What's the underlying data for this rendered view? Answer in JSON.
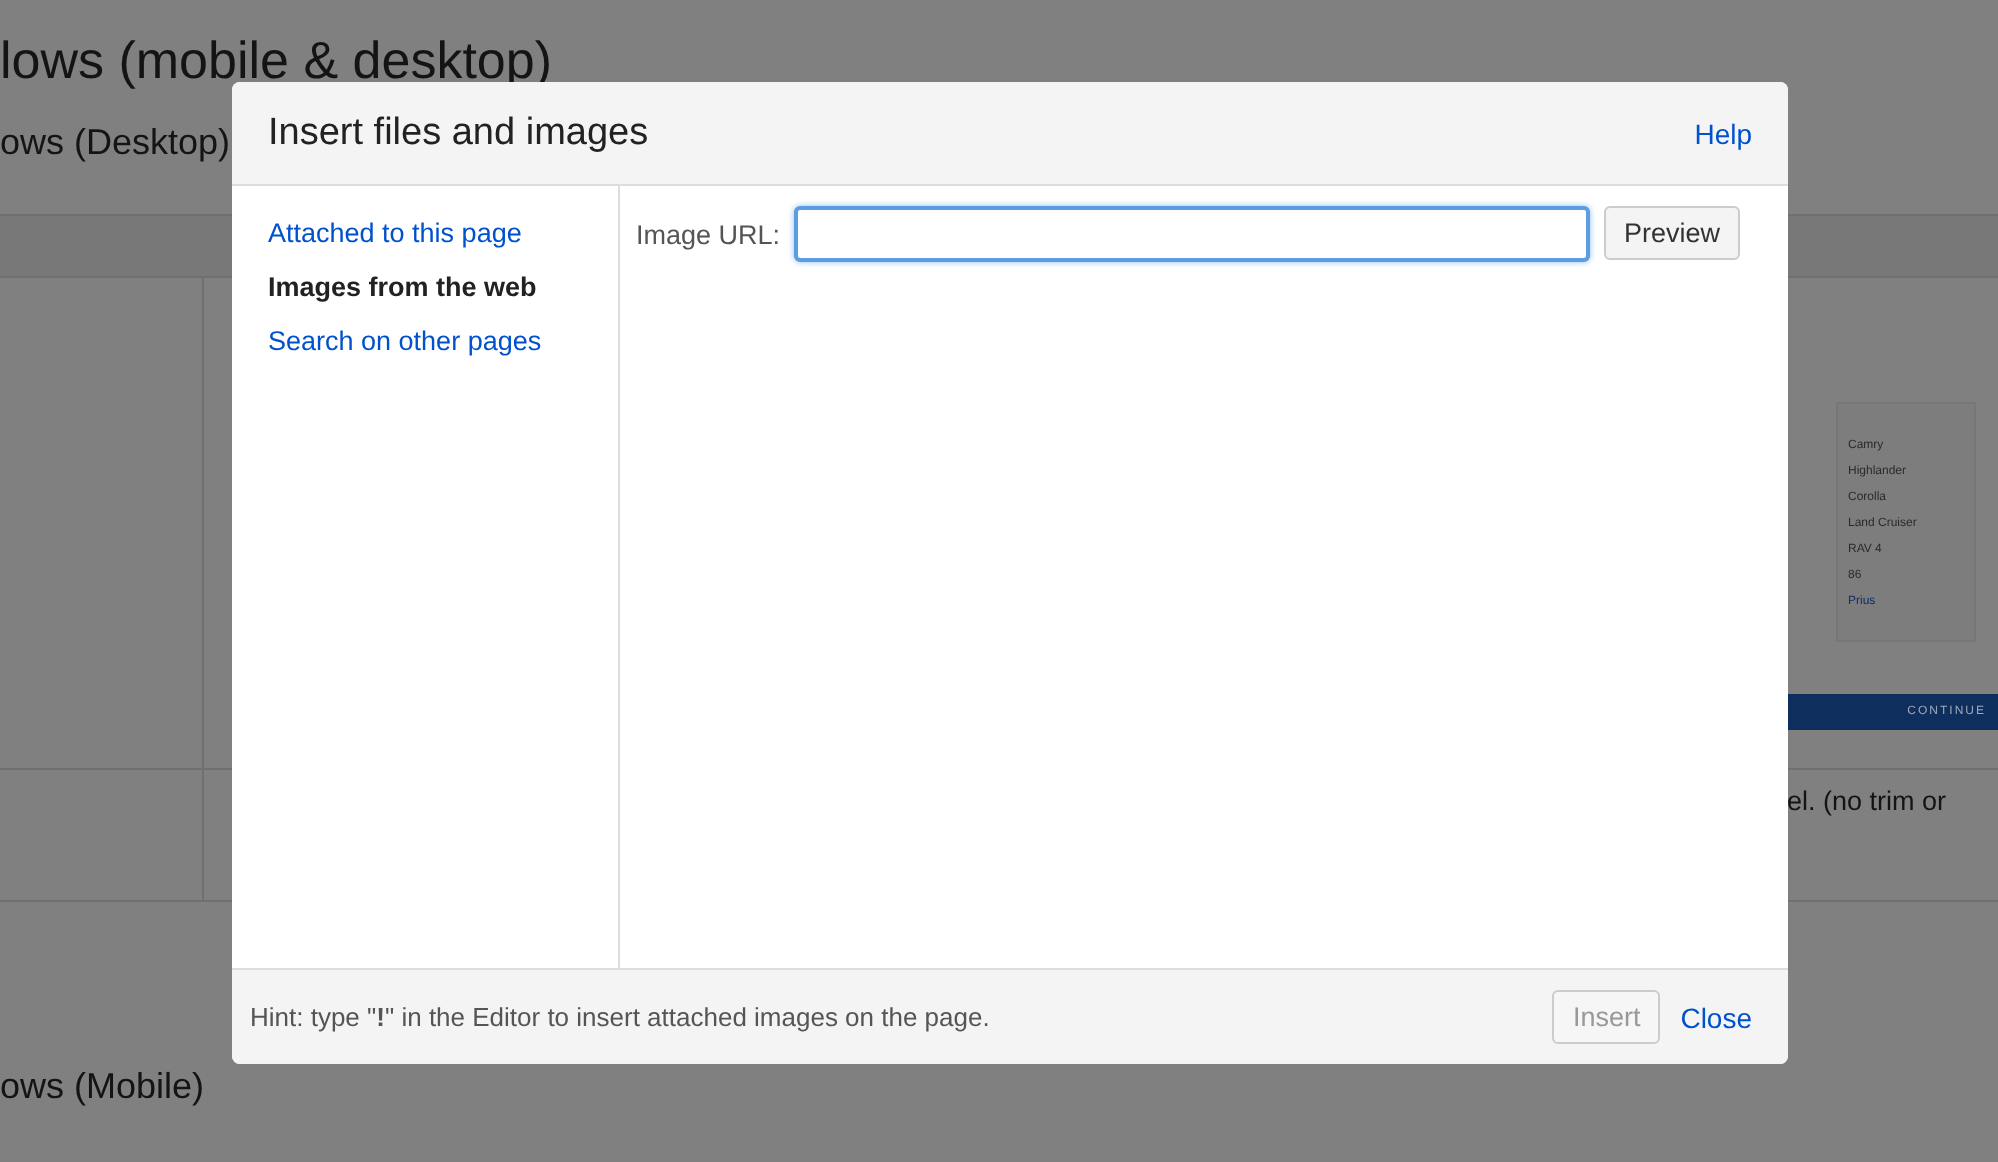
{
  "background": {
    "heading": "lows (mobile & desktop)",
    "subheading": "ows (Desktop)",
    "preview": {
      "models": [
        "Camry",
        "Highlander",
        "Corolla",
        "Land Cruiser",
        "RAV 4",
        "86",
        "Prius"
      ],
      "button": "CONTINUE"
    },
    "cell_text": "el. (no trim or",
    "footer_heading": "ows (Mobile)"
  },
  "dialog": {
    "title": "Insert files and images",
    "help": "Help",
    "nav": [
      {
        "label": "Attached to this page",
        "selected": false
      },
      {
        "label": "Images from the web",
        "selected": true
      },
      {
        "label": "Search on other pages",
        "selected": false
      }
    ],
    "url_label": "Image URL:",
    "preview_button": "Preview",
    "hint": "Hint: type \"**!**\" in the Editor to insert attached images on the page.",
    "buttons": [
      {
        "label": "Insert",
        "kind": "button",
        "disabled": true
      },
      {
        "label": "Close",
        "kind": "link",
        "disabled": false
      }
    ]
  }
}
